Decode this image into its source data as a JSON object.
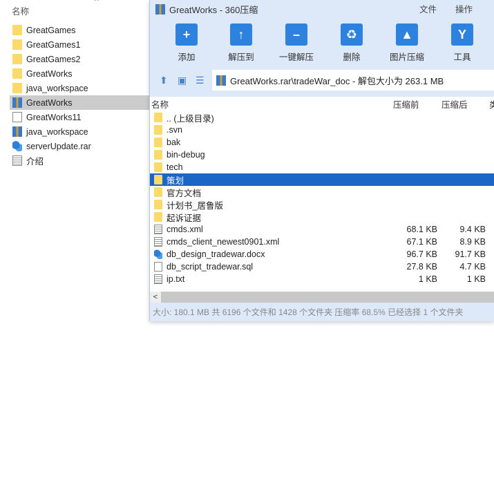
{
  "explorer": {
    "column_header": "名称",
    "items": [
      {
        "name": "GreatGames",
        "icon": "folder"
      },
      {
        "name": "GreatGames1",
        "icon": "folder"
      },
      {
        "name": "GreatGames2",
        "icon": "folder"
      },
      {
        "name": "GreatWorks",
        "icon": "folder"
      },
      {
        "name": "java_workspace",
        "icon": "folder"
      },
      {
        "name": "GreatWorks",
        "icon": "rar",
        "selected": true
      },
      {
        "name": "GreatWorks11",
        "icon": "file"
      },
      {
        "name": "java_workspace",
        "icon": "rar"
      },
      {
        "name": "serverUpdate.rar",
        "icon": "setup"
      },
      {
        "name": "介绍",
        "icon": "txt"
      }
    ]
  },
  "window": {
    "title": "GreatWorks - 360压缩",
    "menu": [
      "文件",
      "操作"
    ],
    "toolbar": [
      {
        "label": "添加",
        "glyph": "+"
      },
      {
        "label": "解压到",
        "glyph": "↑"
      },
      {
        "label": "一键解压",
        "glyph": "–"
      },
      {
        "label": "删除",
        "glyph": "♻"
      },
      {
        "label": "图片压缩",
        "glyph": "▲"
      },
      {
        "label": "工具",
        "glyph": "Y"
      }
    ],
    "address": "GreatWorks.rar\\tradeWar_doc - 解包大小为 263.1 MB",
    "columns": {
      "name": "名称",
      "before": "压缩前",
      "after": "压缩后",
      "type": "类"
    },
    "rows": [
      {
        "name": ".. (上级目录)",
        "icon": "folder",
        "before": "",
        "after": ""
      },
      {
        "name": ".svn",
        "icon": "folder",
        "before": "",
        "after": ""
      },
      {
        "name": "bak",
        "icon": "folder",
        "before": "",
        "after": ""
      },
      {
        "name": "bin-debug",
        "icon": "folder",
        "before": "",
        "after": ""
      },
      {
        "name": "tech",
        "icon": "folder",
        "before": "",
        "after": ""
      },
      {
        "name": "策划",
        "icon": "folder",
        "before": "",
        "after": "",
        "selected": true
      },
      {
        "name": "官方文档",
        "icon": "folder",
        "before": "",
        "after": ""
      },
      {
        "name": "计划书_居鲁版",
        "icon": "folder",
        "before": "",
        "after": ""
      },
      {
        "name": "起诉证据",
        "icon": "folder",
        "before": "",
        "after": ""
      },
      {
        "name": "cmds.xml",
        "icon": "txt",
        "before": "68.1 KB",
        "after": "9.4 KB"
      },
      {
        "name": "cmds_client_newest0901.xml",
        "icon": "txt",
        "before": "67.1 KB",
        "after": "8.9 KB"
      },
      {
        "name": "db_design_tradewar.docx",
        "icon": "setup",
        "before": "96.7 KB",
        "after": "91.7 KB"
      },
      {
        "name": "db_script_tradewar.sql",
        "icon": "file",
        "before": "27.8 KB",
        "after": "4.7 KB"
      },
      {
        "name": "ip.txt",
        "icon": "txt",
        "before": "1 KB",
        "after": "1 KB"
      }
    ],
    "status": "大小: 180.1 MB 共 6196 个文件和 1428 个文件夹 压缩率 68.5% 已经选择 1 个文件夹",
    "scroll_left": "<"
  }
}
